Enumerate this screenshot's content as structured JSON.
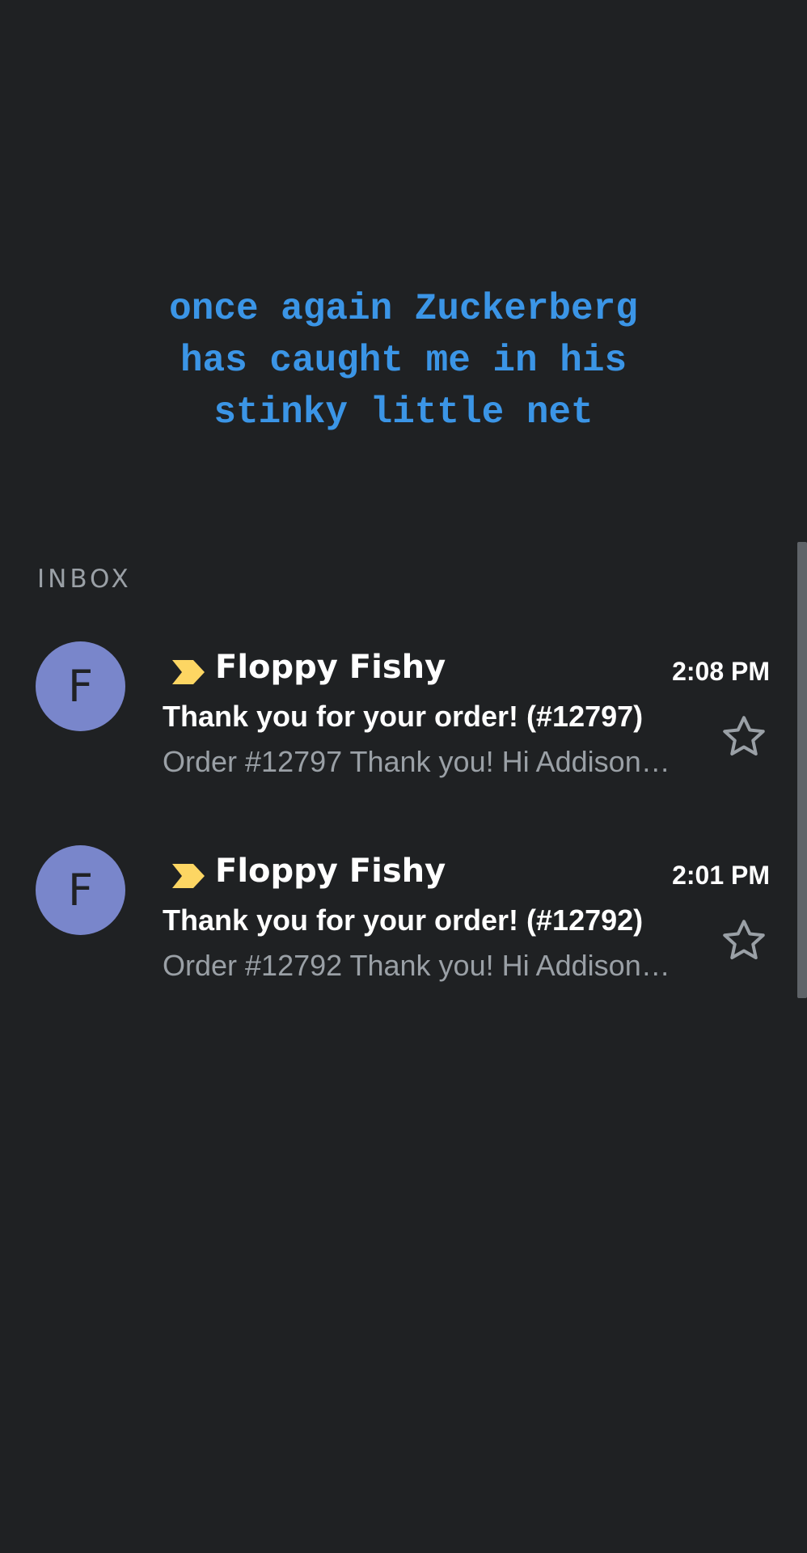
{
  "caption": {
    "lines": [
      "once again Zuckerberg",
      "has caught me in his",
      "stinky little net"
    ],
    "color": "#3b95e6"
  },
  "inbox": {
    "label": "INBOX",
    "emails": [
      {
        "avatar_letter": "F",
        "avatar_color": "#7986cb",
        "importance_icon": "important-marker-icon",
        "sender": "Floppy Fishy",
        "time": "2:08 PM",
        "subject": "Thank you for your order! (#12797)",
        "snippet": "Order #12797 Thank you! Hi Addison…",
        "star_icon": "star-outline-icon"
      },
      {
        "avatar_letter": "F",
        "avatar_color": "#7986cb",
        "importance_icon": "important-marker-icon",
        "sender": "Floppy Fishy",
        "time": "2:01 PM",
        "subject": "Thank you for your order! (#12792)",
        "snippet": "Order #12792 Thank you! Hi Addison…",
        "star_icon": "star-outline-icon"
      }
    ]
  },
  "colors": {
    "background": "#1f2123",
    "importance_marker": "#fdd663",
    "secondary_text": "#9aa0a6"
  }
}
